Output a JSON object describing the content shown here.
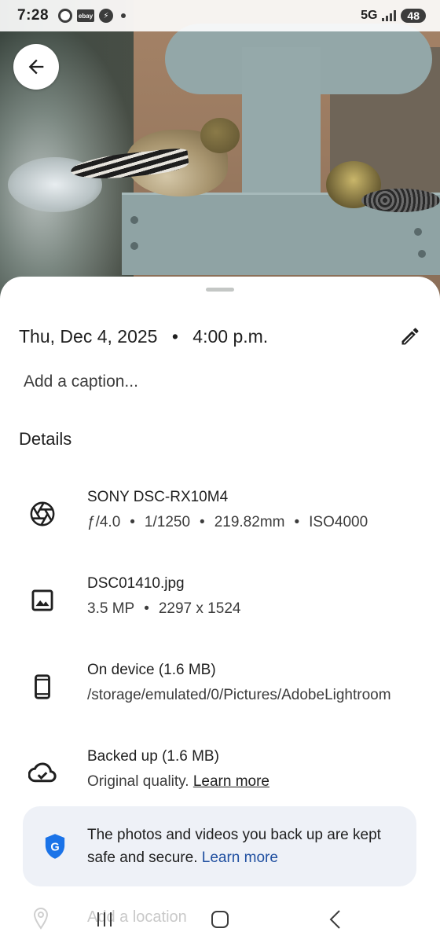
{
  "status_bar": {
    "time": "7:28",
    "network": "5G",
    "battery": "48",
    "notification_icons": [
      "chrome-icon",
      "ebay-icon",
      "messenger-icon",
      "dot-icon"
    ],
    "ebay_text": "ebay"
  },
  "photo": {
    "subject_description_icon": "bird-feeder-photo"
  },
  "sheet": {
    "date": "Thu, Dec 4, 2025",
    "time": "4:00 p.m.",
    "date_separator": "•",
    "caption_placeholder": "Add a caption...",
    "details_title": "Details",
    "items": [
      {
        "icon": "camera-aperture-icon",
        "title": "SONY DSC-RX10M4",
        "specs": [
          "ƒ/4.0",
          "1/1250",
          "219.82mm",
          "ISO4000"
        ]
      },
      {
        "icon": "image-icon",
        "title": "DSC01410.jpg",
        "specs": [
          "3.5 MP",
          "2297 x 1524"
        ]
      },
      {
        "icon": "phone-icon",
        "title": "On device (1.6 MB)",
        "subtitle": "/storage/emulated/0/Pictures/AdobeLightroom"
      },
      {
        "icon": "cloud-done-icon",
        "title": "Backed up (1.6 MB)",
        "subtitle": "Original quality.",
        "subtitle_link": "Learn more"
      }
    ],
    "secure_banner": {
      "message": "The photos and videos you back up are kept safe and secure.",
      "link": "Learn more"
    },
    "location_label": "Add a location"
  },
  "colors": {
    "accent_blue": "#1f4fa0",
    "banner_bg": "#eef1f7",
    "shield_blue": "#1a73e8"
  }
}
